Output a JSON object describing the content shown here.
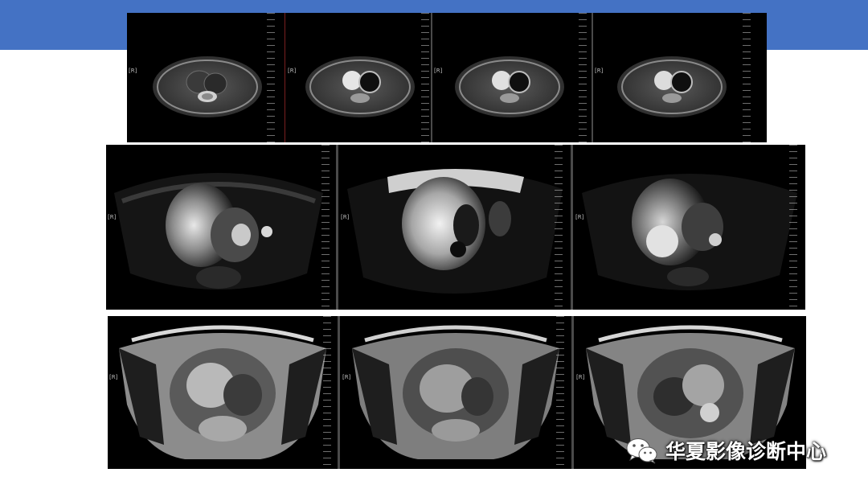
{
  "colors": {
    "accent": "#4472c4",
    "image_background": "#000000"
  },
  "orientation_label": "[R]",
  "watermark": {
    "icon": "wechat-icon",
    "text": "华夏影像诊断中心"
  },
  "rows": [
    {
      "row": "top",
      "frame_count": 4
    },
    {
      "row": "middle",
      "frame_count": 3
    },
    {
      "row": "bottom",
      "frame_count": 3
    }
  ]
}
